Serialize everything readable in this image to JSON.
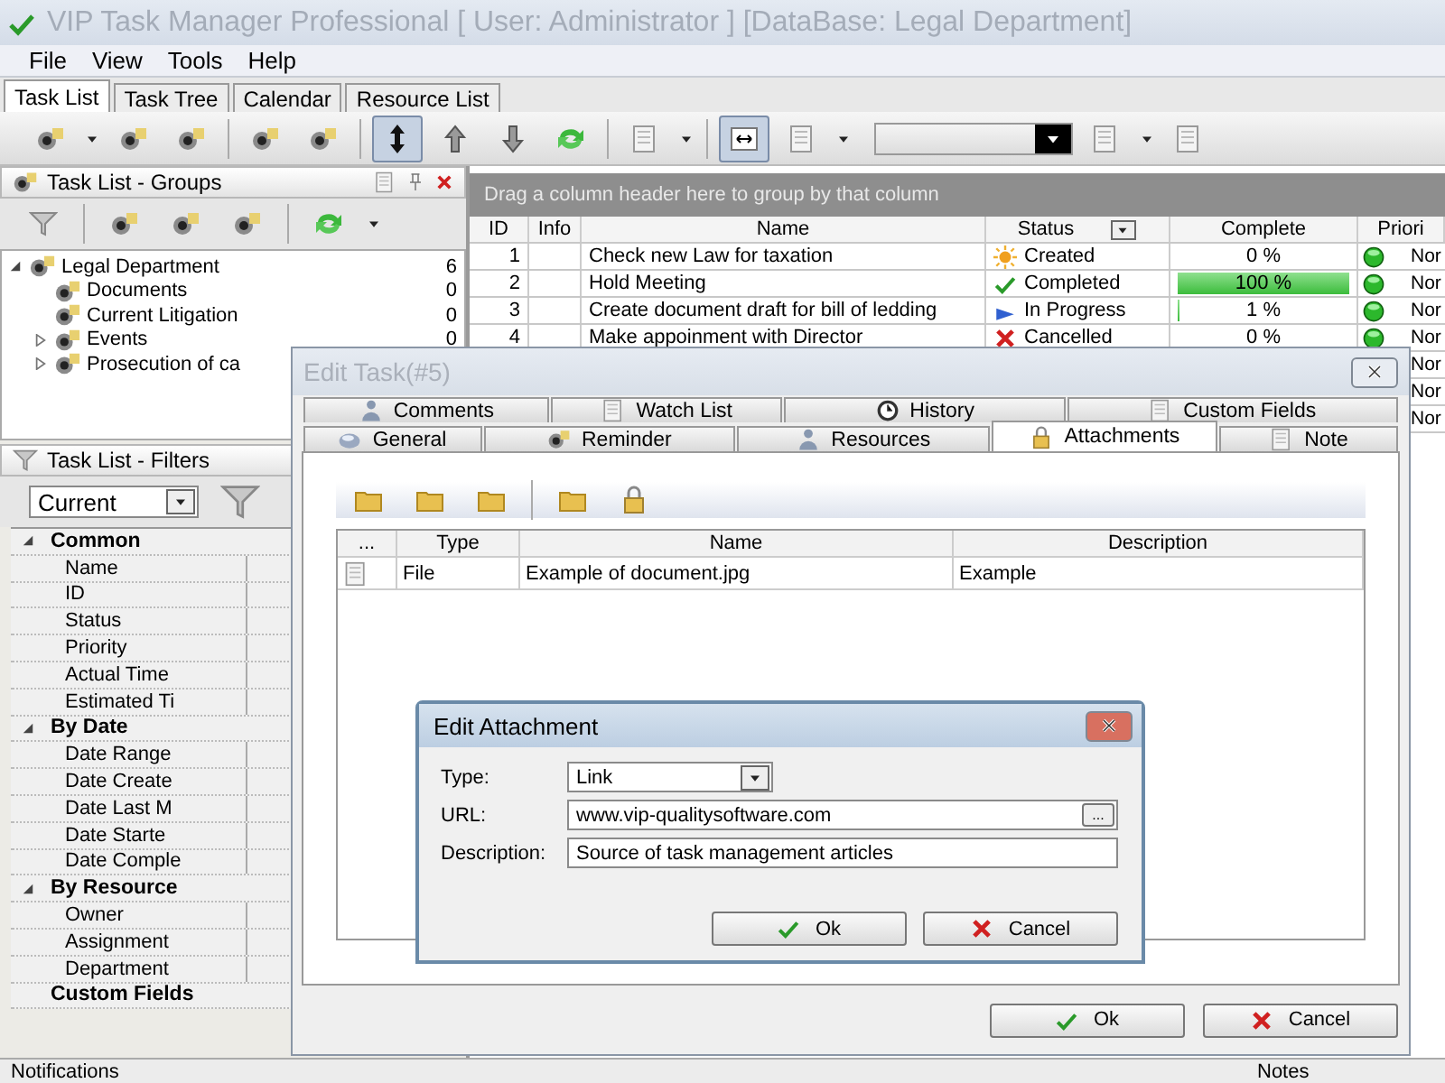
{
  "window": {
    "title": "VIP Task Manager Professional [ User: Administrator ] [DataBase: Legal Department]"
  },
  "menu": [
    "File",
    "View",
    "Tools",
    "Help"
  ],
  "view_tabs": [
    {
      "label": "Task List",
      "selected": true
    },
    {
      "label": "Task Tree",
      "selected": false
    },
    {
      "label": "Calendar",
      "selected": false
    },
    {
      "label": "Resource List",
      "selected": false
    }
  ],
  "groups_panel": {
    "title": "Task List - Groups",
    "tree": [
      {
        "label": "Legal Department",
        "count": "6",
        "expanded": true,
        "children": [
          {
            "label": "Documents",
            "count": "0"
          },
          {
            "label": "Current Litigation",
            "count": "0"
          },
          {
            "label": "Events",
            "count": "0",
            "expanded": false
          },
          {
            "label": "Prosecution of ca",
            "expanded": false
          }
        ]
      }
    ]
  },
  "filters_panel": {
    "title": "Task List - Filters",
    "preset": "Current",
    "categories": [
      {
        "label": "Common",
        "expanded": true,
        "children": [
          "Name",
          "ID",
          "Status",
          "Priority",
          "Actual Time",
          "Estimated Ti"
        ]
      },
      {
        "label": "By Date",
        "expanded": true,
        "children": [
          "Date Range",
          "Date Create",
          "Date Last M",
          "Date Starte",
          "Date Comple"
        ]
      },
      {
        "label": "By Resource",
        "expanded": true,
        "children": [
          "Owner",
          "Assignment",
          "Department"
        ]
      },
      {
        "label": "Custom Fields"
      }
    ]
  },
  "grid": {
    "group_hint": "Drag a column header here to group by that column",
    "columns": [
      "ID",
      "Info",
      "Name",
      "Status",
      "Complete",
      "Priori"
    ],
    "rows": [
      {
        "id": "1",
        "name": "Check new Law for taxation",
        "status": "Created",
        "kind": "created",
        "complete": "0 %",
        "priority": "Nor"
      },
      {
        "id": "2",
        "name": "Hold Meeting",
        "status": "Completed",
        "kind": "completed",
        "complete": "100 %",
        "level": 1,
        "priority": "Nor"
      },
      {
        "id": "3",
        "name": "Create document draft for bill of ledding",
        "status": "In Progress",
        "kind": "progress",
        "complete": "1 %",
        "level": 0.01,
        "priority": "Nor"
      },
      {
        "id": "4",
        "name": "Make appoinment with Director",
        "status": "Cancelled",
        "kind": "cancelled",
        "complete": "0 %",
        "priority": "Nor"
      },
      {
        "priority": "Nor"
      },
      {
        "priority": "Nor"
      },
      {
        "priority": "Nor"
      }
    ]
  },
  "edit_task": {
    "title": "Edit Task(#5)",
    "tabs_top": [
      {
        "label": "Comments",
        "selected": false
      },
      {
        "label": "Watch List",
        "selected": false
      },
      {
        "label": "History",
        "selected": false
      },
      {
        "label": "Custom Fields",
        "selected": false
      }
    ],
    "tabs_bottom": [
      {
        "label": "General",
        "selected": false
      },
      {
        "label": "Reminder",
        "selected": false
      },
      {
        "label": "Resources",
        "selected": false
      },
      {
        "label": "Attachments",
        "selected": true
      },
      {
        "label": "Note",
        "selected": false
      }
    ],
    "attachments": {
      "columns": [
        "...",
        "Type",
        "Name",
        "Description"
      ],
      "rows": [
        {
          "type": "File",
          "name": "Example of document.jpg",
          "description": "Example"
        }
      ]
    },
    "buttons": [
      {
        "label": "Ok",
        "kind": "ok"
      },
      {
        "label": "Cancel",
        "kind": "cancel"
      }
    ]
  },
  "edit_attachment": {
    "title": "Edit Attachment",
    "type_label": "Type:",
    "type_value": "Link",
    "url_label": "URL:",
    "url": "www.vip-qualitysoftware.com",
    "browse": "...",
    "description_label": "Description:",
    "description": "Source of task management articles",
    "buttons": [
      {
        "label": "Ok",
        "kind": "ok"
      },
      {
        "label": "Cancel",
        "kind": "cancel"
      }
    ]
  },
  "status_bar": {
    "left": "Notifications",
    "right": "Notes"
  }
}
